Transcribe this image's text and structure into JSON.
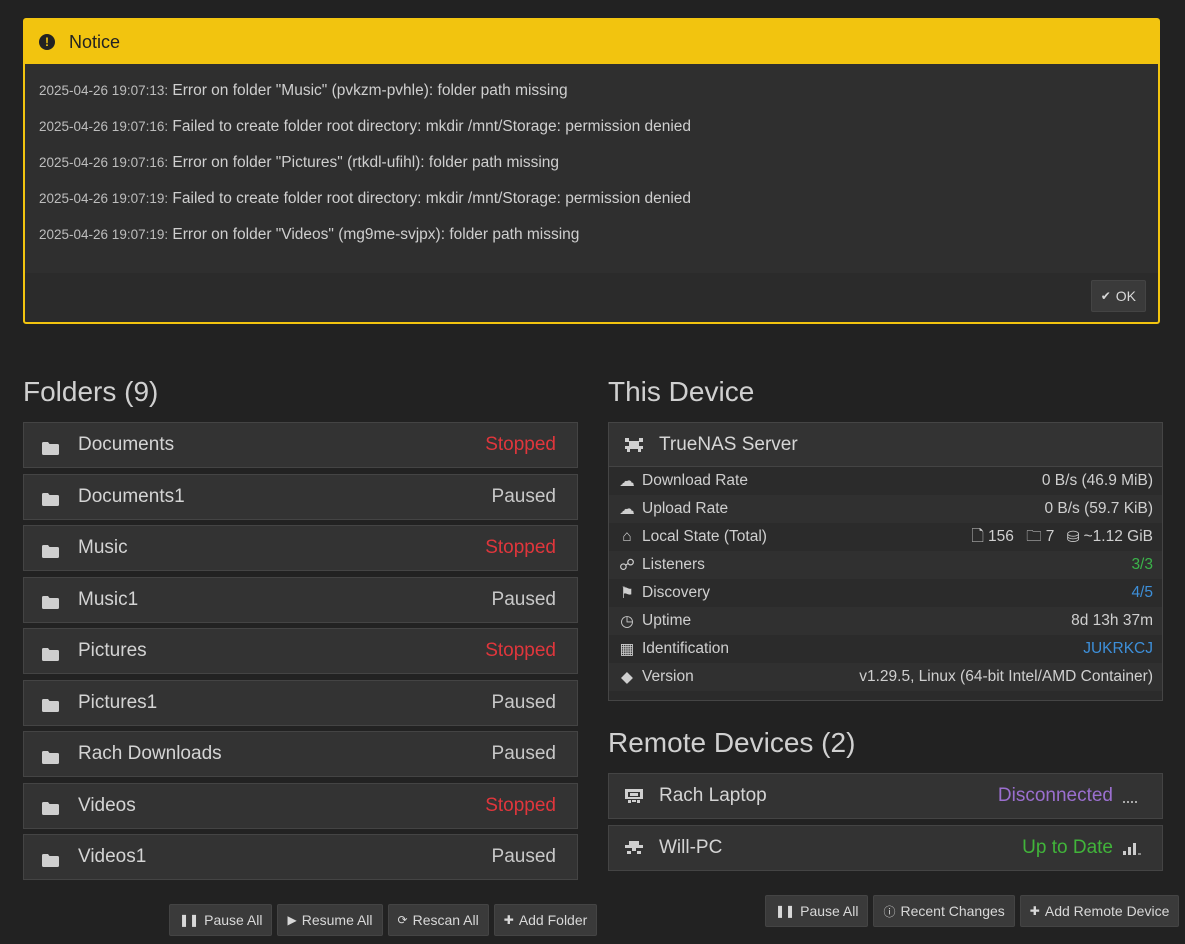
{
  "notice": {
    "title": "Notice",
    "messages": [
      {
        "ts": "2025-04-26 19:07:13:",
        "text": "Error on folder \"Music\" (pvkzm-pvhle): folder path missing"
      },
      {
        "ts": "2025-04-26 19:07:16:",
        "text": "Failed to create folder root directory: mkdir /mnt/Storage: permission denied"
      },
      {
        "ts": "2025-04-26 19:07:16:",
        "text": "Error on folder \"Pictures\" (rtkdl-ufihl): folder path missing"
      },
      {
        "ts": "2025-04-26 19:07:19:",
        "text": "Failed to create folder root directory: mkdir /mnt/Storage: permission denied"
      },
      {
        "ts": "2025-04-26 19:07:19:",
        "text": "Error on folder \"Videos\" (mg9me-svjpx): folder path missing"
      }
    ],
    "ok_label": "OK"
  },
  "folders": {
    "heading": "Folders (9)",
    "items": [
      {
        "name": "Documents",
        "status": "Stopped"
      },
      {
        "name": "Documents1",
        "status": "Paused"
      },
      {
        "name": "Music",
        "status": "Stopped"
      },
      {
        "name": "Music1",
        "status": "Paused"
      },
      {
        "name": "Pictures",
        "status": "Stopped"
      },
      {
        "name": "Pictures1",
        "status": "Paused"
      },
      {
        "name": "Rach Downloads",
        "status": "Paused"
      },
      {
        "name": "Videos",
        "status": "Stopped"
      },
      {
        "name": "Videos1",
        "status": "Paused"
      }
    ],
    "buttons": {
      "pause_all": "Pause All",
      "resume_all": "Resume All",
      "rescan_all": "Rescan All",
      "add_folder": "Add Folder"
    }
  },
  "this_device": {
    "heading": "This Device",
    "name": "TrueNAS Server",
    "rows": {
      "download_rate": {
        "label": "Download Rate",
        "value": "0 B/s (46.9 MiB)"
      },
      "upload_rate": {
        "label": "Upload Rate",
        "value": "0 B/s (59.7 KiB)"
      },
      "local_state": {
        "label": "Local State (Total)",
        "files": "156",
        "dirs": "7",
        "size": "~1.12 GiB"
      },
      "listeners": {
        "label": "Listeners",
        "value": "3/3"
      },
      "discovery": {
        "label": "Discovery",
        "value": "4/5"
      },
      "uptime": {
        "label": "Uptime",
        "value": "8d 13h 37m"
      },
      "identification": {
        "label": "Identification",
        "value": "JUKRKCJ"
      },
      "version": {
        "label": "Version",
        "value": "v1.29.5, Linux (64-bit Intel/AMD Container)"
      }
    }
  },
  "remote_devices": {
    "heading": "Remote Devices (2)",
    "items": [
      {
        "name": "Rach Laptop",
        "status": "Disconnected",
        "status_color": "#9b6fcf"
      },
      {
        "name": "Will-PC",
        "status": "Up to Date",
        "status_color": "#41b43a"
      }
    ],
    "buttons": {
      "pause_all": "Pause All",
      "recent_changes": "Recent Changes",
      "add_remote_device": "Add Remote Device"
    }
  },
  "colors": {
    "notice": "#f2c40f",
    "stopped": "#e0363c",
    "green": "#3bb34a",
    "blue": "#3d8fd9"
  }
}
